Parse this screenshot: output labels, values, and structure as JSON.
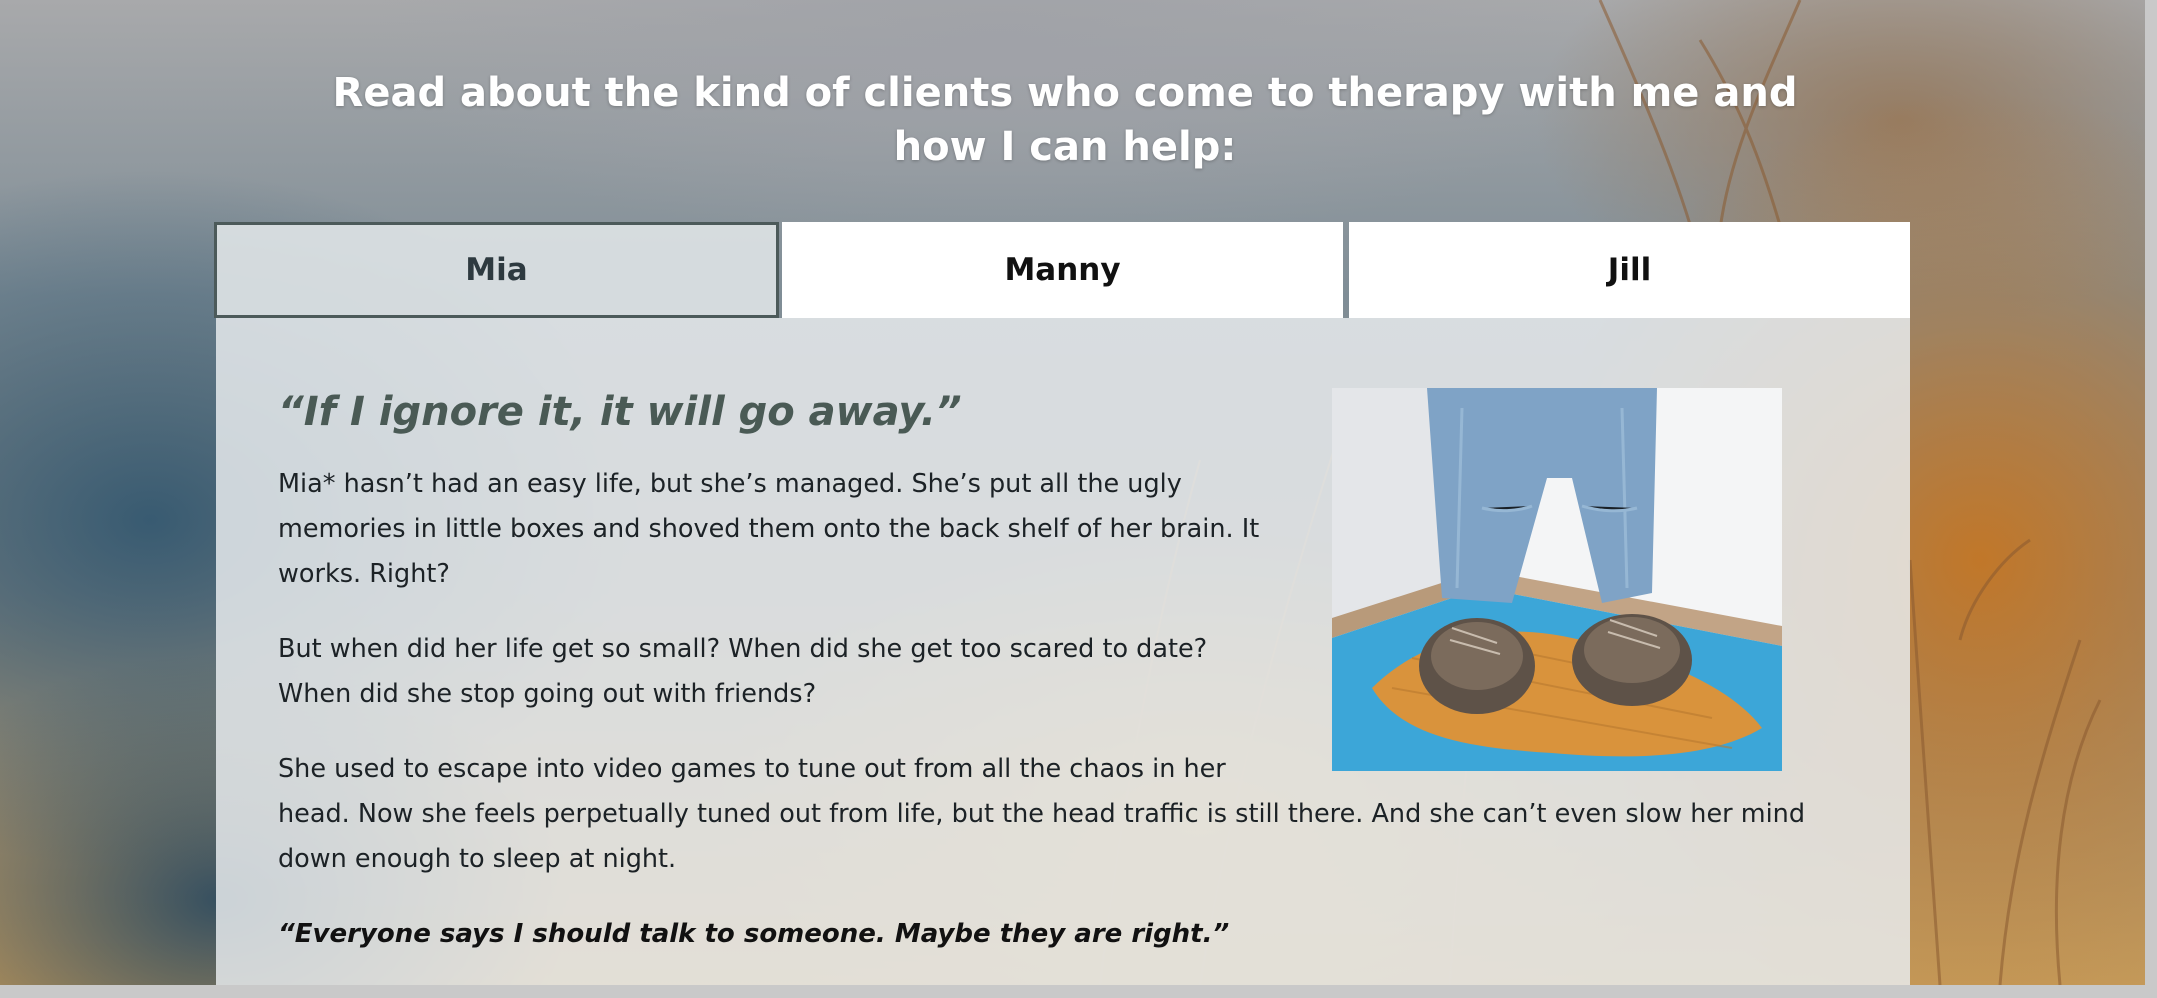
{
  "heading": "Read about the kind of clients who come to therapy with me and how I can help:",
  "tabs": [
    {
      "label": "Mia",
      "active": true
    },
    {
      "label": "Manny",
      "active": false
    },
    {
      "label": "Jill",
      "active": false
    }
  ],
  "story": {
    "quote_title": "“If I ignore it, it will go away.”",
    "paragraphs": [
      "Mia* hasn’t had an easy life, but she’s managed. She’s put all the ugly memories in little boxes and shoved them onto the back shelf of her brain. It works. Right?",
      "But when did her life get so small? When did she get too scared to date? When did she stop going out with friends?",
      "She used to escape into video games to tune out from all the chaos in her head. Now she feels perpetually tuned out from life, but the head traffic is still there. And she can’t even slow her mind down enough to sleep at night."
    ],
    "closing_quote": "“Everyone says I should talk to someone. Maybe they are right.”",
    "photo_icon": "person-standing-in-corner-photo"
  },
  "colors": {
    "tab_active_bg": "#dce2e4",
    "tab_active_border": "#4c5a5a",
    "quote_title": "#4a5a55",
    "text": "#1c2226"
  }
}
